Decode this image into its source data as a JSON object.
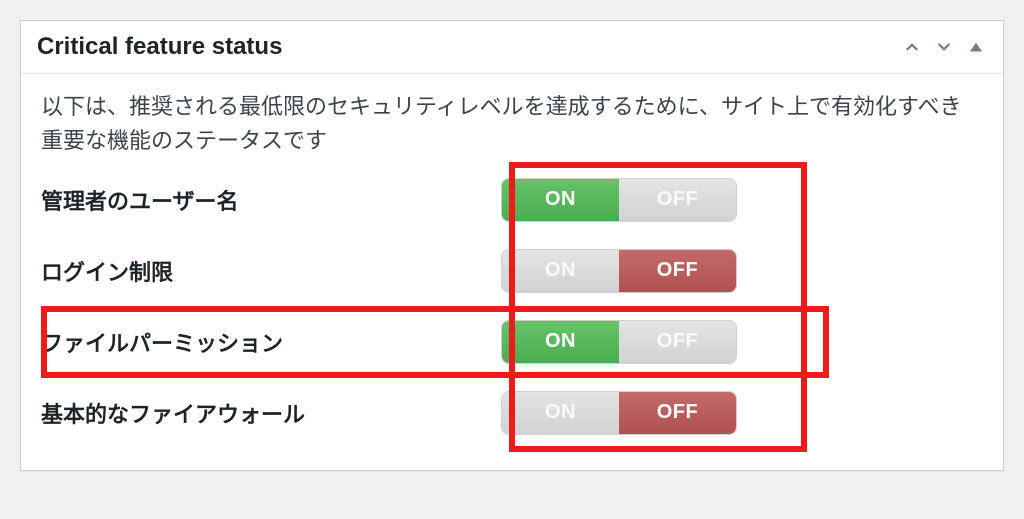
{
  "widget": {
    "title": "Critical feature status",
    "description": "以下は、推奨される最低限のセキュリティレベルを達成するために、サイト上で有効化すべき重要な機能のステータスです"
  },
  "toggle_labels": {
    "on": "ON",
    "off": "OFF"
  },
  "features": [
    {
      "label": "管理者のユーザー名",
      "state": "on"
    },
    {
      "label": "ログイン制限",
      "state": "off"
    },
    {
      "label": "ファイルパーミッション",
      "state": "on"
    },
    {
      "label": "基本的なファイアウォール",
      "state": "off"
    }
  ],
  "highlight": {
    "color": "#ef1b1b"
  }
}
